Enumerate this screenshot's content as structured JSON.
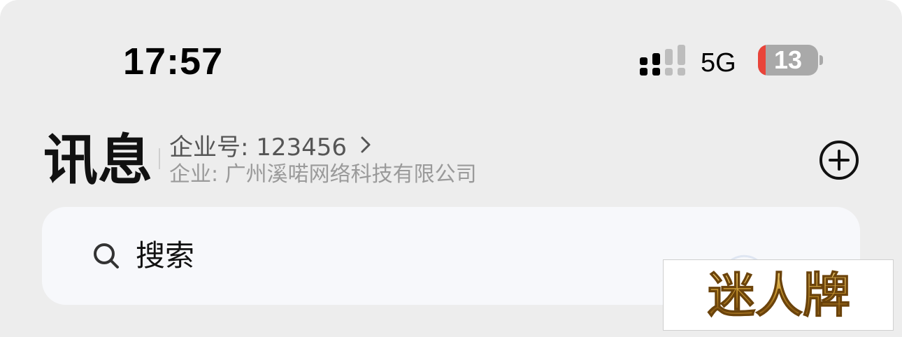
{
  "status_bar": {
    "time": "17:57",
    "network": "5G",
    "battery_percent": "13",
    "battery_level": 0.13,
    "signal_icon": "signal-bars-icon"
  },
  "header": {
    "title": "讯息",
    "enterprise_id_label": "企业号: 123456",
    "enterprise_name": "企业: 广州溪喏网络科技有限公司",
    "add_icon": "plus-circle-icon"
  },
  "search": {
    "placeholder": "搜索",
    "icon": "search-icon"
  },
  "watermark": {
    "text": "迷人牌"
  },
  "colors": {
    "background": "#ededed",
    "search_bg": "#f7f8fb",
    "battery_low": "#e9443a",
    "battery_body": "#a9a9a9",
    "watermark_gold": "#c8962e"
  }
}
